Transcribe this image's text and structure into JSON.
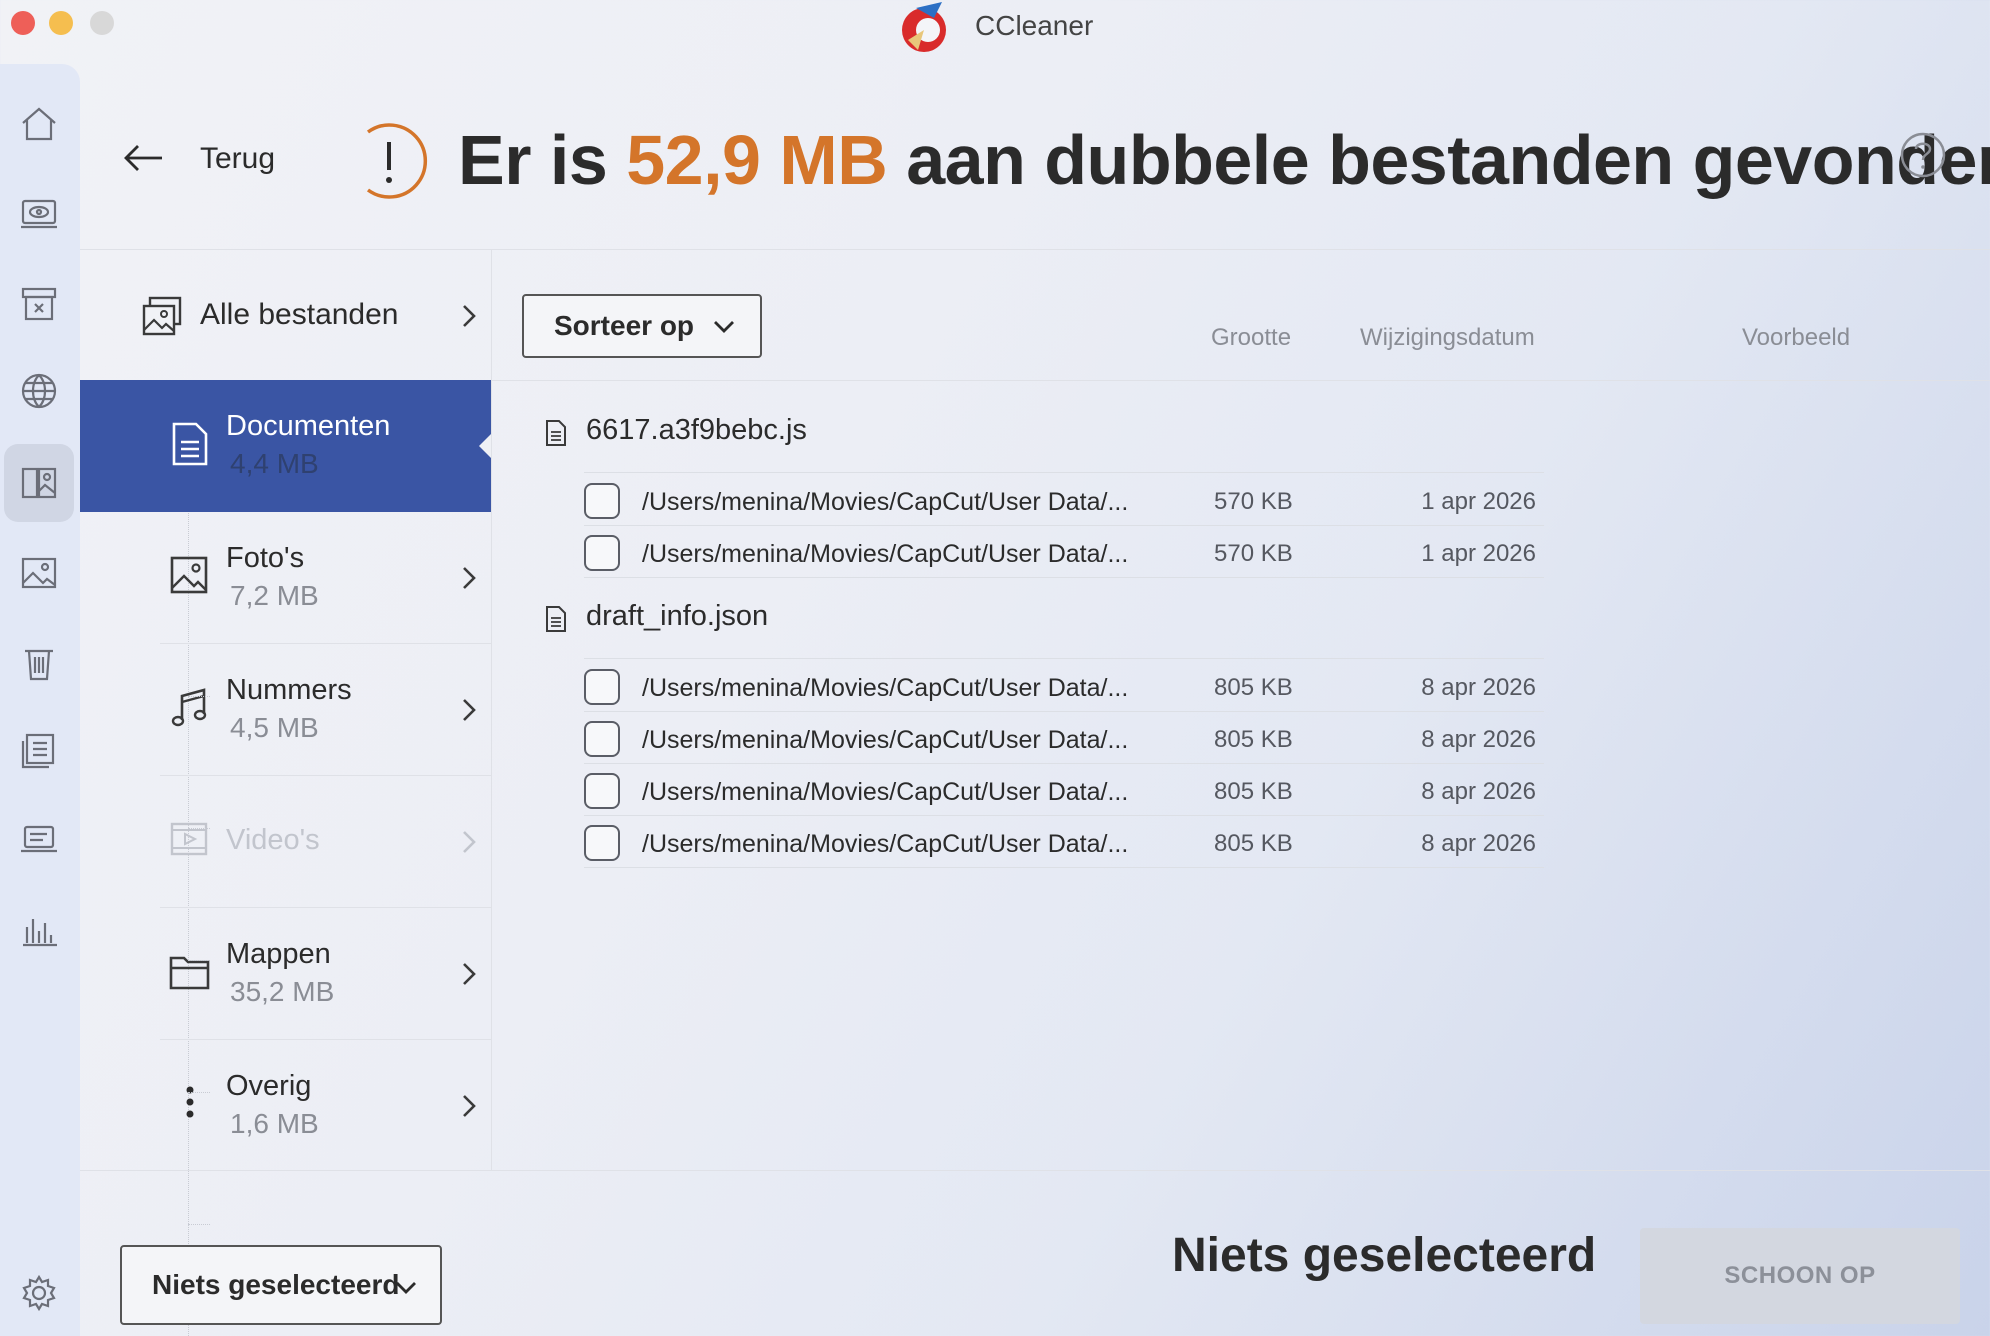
{
  "window": {
    "title": "CCleaner"
  },
  "header": {
    "back_label": "Terug",
    "headline_prefix": "Er is ",
    "headline_amount": "52,9 MB",
    "headline_suffix": " aan dubbele bestanden gevonden"
  },
  "colors": {
    "accent": "#d4752a",
    "active_category": "#3a55a4"
  },
  "rail": {
    "items": [
      {
        "icon": "home-icon"
      },
      {
        "icon": "monitor-eye-icon"
      },
      {
        "icon": "archive-x-icon"
      },
      {
        "icon": "globe-icon"
      },
      {
        "icon": "duplicate-images-icon"
      },
      {
        "icon": "image-icon"
      },
      {
        "icon": "trash-icon"
      },
      {
        "icon": "list-settings-icon"
      },
      {
        "icon": "laptop-icon"
      },
      {
        "icon": "bar-chart-icon"
      }
    ],
    "settings_icon": "gear-icon"
  },
  "categories": {
    "all_label": "Alle bestanden",
    "items": [
      {
        "name": "Documenten",
        "size": "4,4 MB",
        "icon": "document-icon",
        "active": true
      },
      {
        "name": "Foto's",
        "size": "7,2 MB",
        "icon": "image-icon"
      },
      {
        "name": "Nummers",
        "size": "4,5 MB",
        "icon": "music-note-icon"
      },
      {
        "name": "Video's",
        "size": "",
        "icon": "video-icon",
        "disabled": true
      },
      {
        "name": "Mappen",
        "size": "35,2 MB",
        "icon": "folder-icon"
      },
      {
        "name": "Overig",
        "size": "1,6 MB",
        "icon": "more-vertical-icon"
      }
    ]
  },
  "toolbar": {
    "sort_label": "Sorteer op"
  },
  "columns": {
    "size": "Grootte",
    "date": "Wijzigingsdatum",
    "preview": "Voorbeeld"
  },
  "groups": [
    {
      "name": "6617.a3f9bebc.js",
      "files": [
        {
          "path": "/Users/menina/Movies/CapCut/User Data/...",
          "size": "570 KB",
          "date": "1 apr 2026"
        },
        {
          "path": "/Users/menina/Movies/CapCut/User Data/...",
          "size": "570 KB",
          "date": "1 apr 2026"
        }
      ]
    },
    {
      "name": "draft_info.json",
      "files": [
        {
          "path": "/Users/menina/Movies/CapCut/User Data/...",
          "size": "805 KB",
          "date": "8 apr 2026"
        },
        {
          "path": "/Users/menina/Movies/CapCut/User Data/...",
          "size": "805 KB",
          "date": "8 apr 2026"
        },
        {
          "path": "/Users/menina/Movies/CapCut/User Data/...",
          "size": "805 KB",
          "date": "8 apr 2026"
        },
        {
          "path": "/Users/menina/Movies/CapCut/User Data/...",
          "size": "805 KB",
          "date": "8 apr 2026"
        }
      ]
    }
  ],
  "footer": {
    "selection_dropdown": "Niets geselecteerd",
    "status": "Niets geselecteerd",
    "clean_button": "SCHOON OP"
  }
}
